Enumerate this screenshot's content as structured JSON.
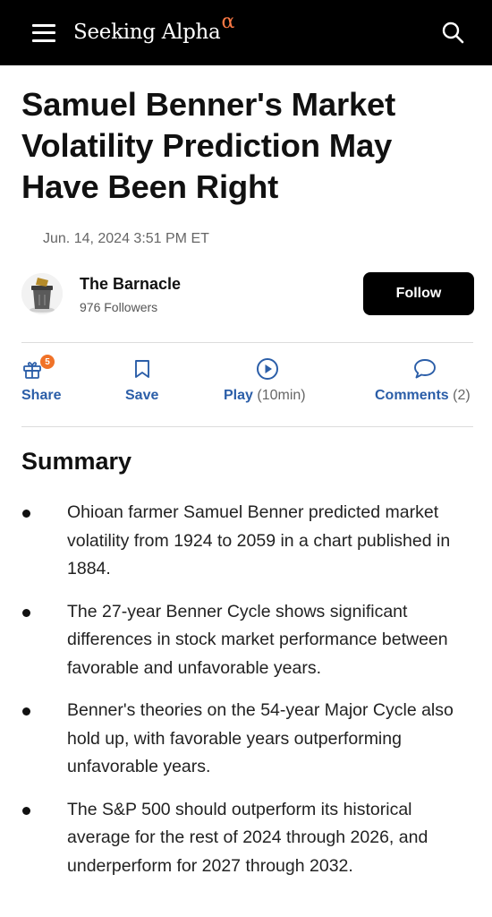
{
  "header": {
    "logo_text": "Seeking Alpha",
    "logo_mark": "α",
    "menu_icon": "hamburger-menu-icon",
    "search_icon": "search-icon",
    "background": "#000000",
    "accent": "#ff7a45"
  },
  "article": {
    "title": "Samuel Benner's Market Volatility Prediction May Have Been Right",
    "date": "Jun. 14, 2024 3:51 PM ET"
  },
  "author": {
    "name": "The Barnacle",
    "followers": "976 Followers",
    "follow_label": "Follow"
  },
  "actions": {
    "share": {
      "label": "Share",
      "badge": "5",
      "icon": "gift-icon"
    },
    "save": {
      "label": "Save",
      "icon": "bookmark-icon"
    },
    "play": {
      "label": "Play",
      "sub": "(10min)",
      "icon": "play-circle-icon"
    },
    "comments": {
      "label": "Comments",
      "sub": "(2)",
      "icon": "comment-bubble-icon"
    },
    "color": "#2b5ea8",
    "badge_color": "#f07228"
  },
  "summary": {
    "title": "Summary",
    "items": [
      "Ohioan farmer Samuel Benner predicted market volatility from 1924 to 2059 in a chart published in 1884.",
      "The 27-year Benner Cycle shows significant differences in stock market performance between favorable and unfavorable years.",
      "Benner's theories on the 54-year Major Cycle also hold up, with favorable years outperforming unfavorable years.",
      "The S&P 500 should outperform its historical average for the rest of 2024 through 2026, and underperform for 2027 through 2032."
    ]
  }
}
